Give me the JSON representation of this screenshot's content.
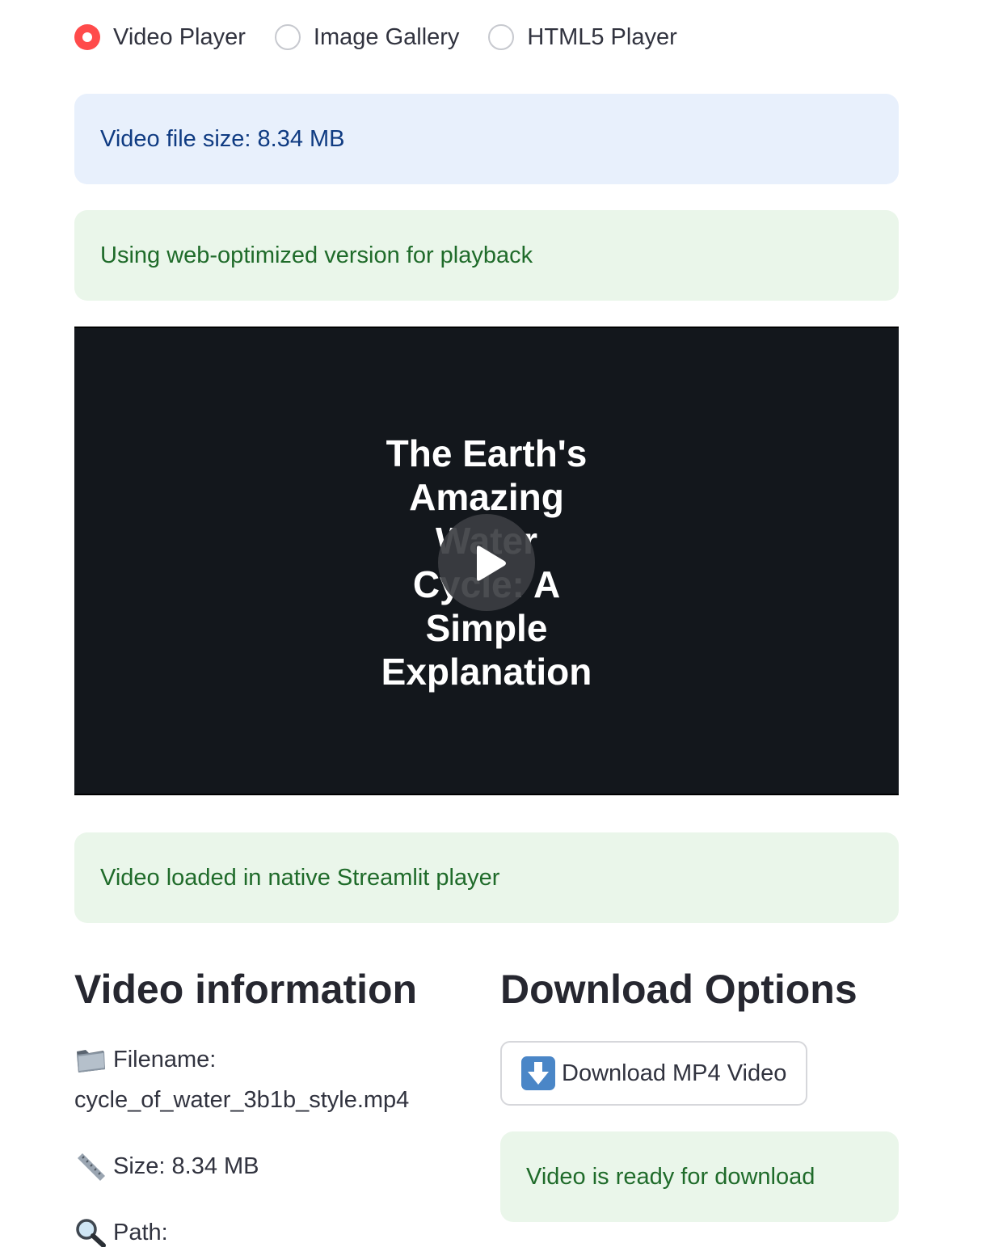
{
  "player_mode": {
    "options": [
      {
        "label": "Video Player",
        "selected": true
      },
      {
        "label": "Image Gallery",
        "selected": false
      },
      {
        "label": "HTML5 Player",
        "selected": false
      }
    ]
  },
  "alerts": {
    "file_size": "Video file size: 8.34 MB",
    "web_optimized": "Using web-optimized version for playback",
    "loaded": "Video loaded in native Streamlit player"
  },
  "video": {
    "title_lines": [
      "The Earth's",
      "Amazing",
      "Water",
      "Cycle: A",
      "Simple",
      "Explanation"
    ],
    "state": "paused",
    "play_icon": "play-icon"
  },
  "video_info": {
    "heading": "Video information",
    "filename_label": "Filename:",
    "filename_value": "cycle_of_water_3b1b_style.mp4",
    "size_label": "Size: 8.34 MB",
    "path_label": "Path:",
    "icons": [
      "folder-icon",
      "ruler-icon",
      "magnifier-icon"
    ]
  },
  "download": {
    "heading": "Download Options",
    "button_label": "Download MP4 Video",
    "button_icon": "down-arrow-icon",
    "ready_text": "Video is ready for download"
  },
  "colors": {
    "accent": "#ff4b4b",
    "info_bg": "#e8f0fc",
    "info_text": "#0f3b82",
    "success_bg": "#eaf6ea",
    "success_text": "#1f6b2a",
    "video_bg": "#13171c"
  }
}
